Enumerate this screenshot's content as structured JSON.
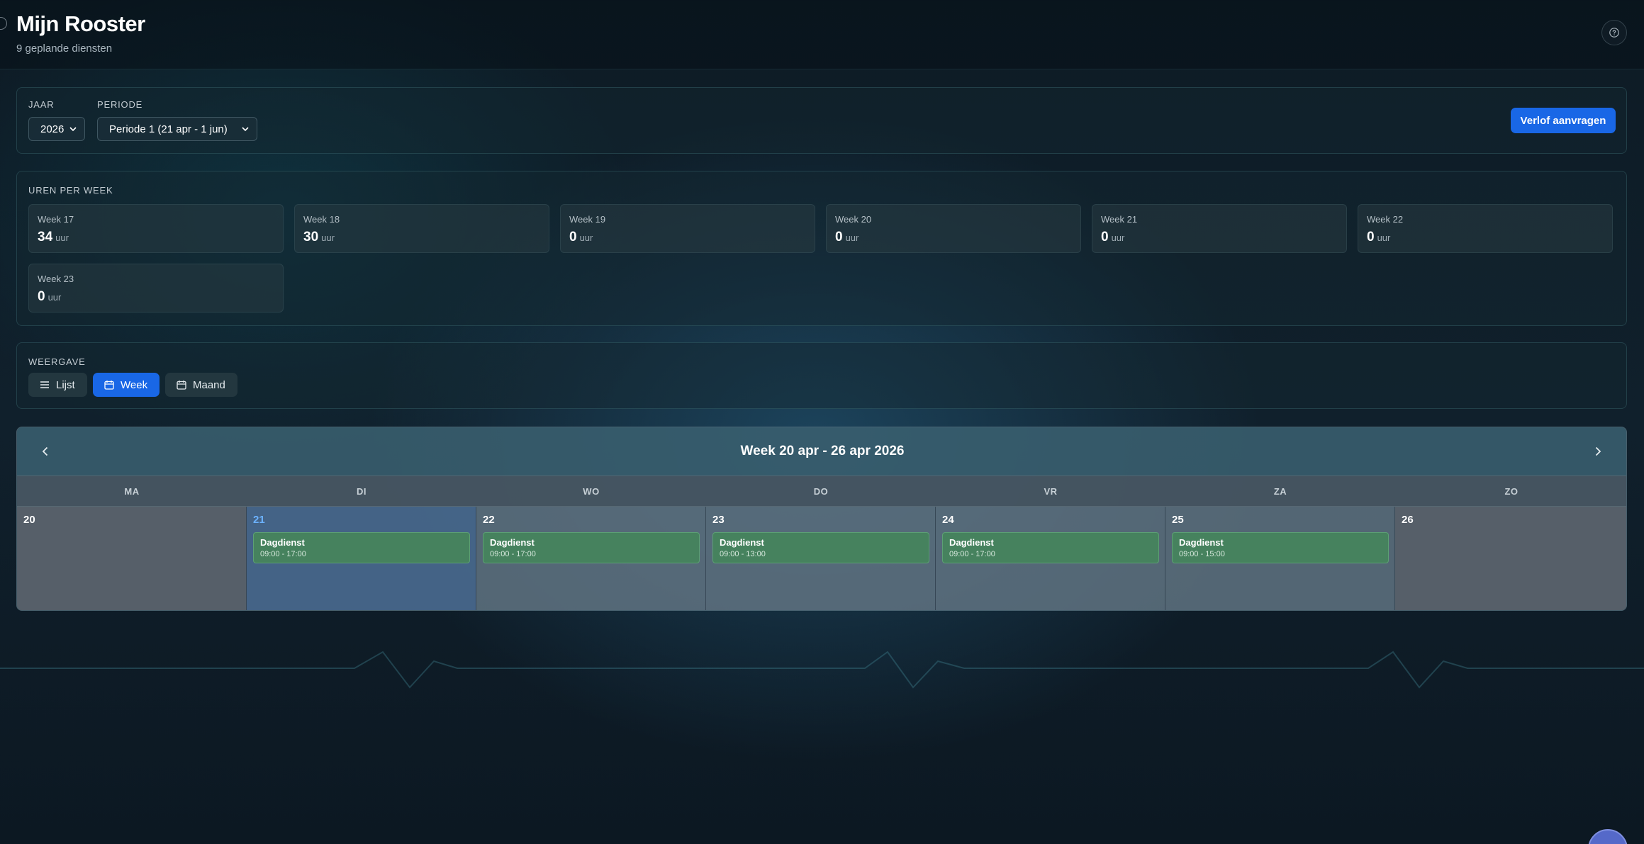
{
  "header": {
    "title": "Mijn Rooster",
    "subtitle": "9 geplande diensten",
    "help_icon": "help-circle-icon"
  },
  "filters": {
    "year_label": "JAAR",
    "year_value": "2026",
    "period_label": "PERIODE",
    "period_value": "Periode 1 (21 apr - 1 jun)",
    "leave_button": "Verlof aanvragen"
  },
  "hours": {
    "title": "UREN PER WEEK",
    "unit": "uur",
    "weeks": [
      {
        "label": "Week 17",
        "value": "34"
      },
      {
        "label": "Week 18",
        "value": "30"
      },
      {
        "label": "Week 19",
        "value": "0"
      },
      {
        "label": "Week 20",
        "value": "0"
      },
      {
        "label": "Week 21",
        "value": "0"
      },
      {
        "label": "Week 22",
        "value": "0"
      },
      {
        "label": "Week 23",
        "value": "0"
      }
    ]
  },
  "view": {
    "title": "WEERGAVE",
    "options": [
      {
        "label": "Lijst",
        "icon": "list-icon",
        "active": false
      },
      {
        "label": "Week",
        "icon": "calendar-icon",
        "active": true
      },
      {
        "label": "Maand",
        "icon": "calendar-icon",
        "active": false
      }
    ]
  },
  "calendar": {
    "title": "Week 20 apr - 26 apr 2026",
    "days": [
      {
        "dow": "MA",
        "date": "20",
        "state": "muted",
        "shift": null
      },
      {
        "dow": "DI",
        "date": "21",
        "state": "today",
        "shift": {
          "name": "Dagdienst",
          "time": "09:00 - 17:00"
        }
      },
      {
        "dow": "WO",
        "date": "22",
        "state": "normal",
        "shift": {
          "name": "Dagdienst",
          "time": "09:00 - 17:00"
        }
      },
      {
        "dow": "DO",
        "date": "23",
        "state": "normal",
        "shift": {
          "name": "Dagdienst",
          "time": "09:00 - 13:00"
        }
      },
      {
        "dow": "VR",
        "date": "24",
        "state": "normal",
        "shift": {
          "name": "Dagdienst",
          "time": "09:00 - 17:00"
        }
      },
      {
        "dow": "ZA",
        "date": "25",
        "state": "normal",
        "shift": {
          "name": "Dagdienst",
          "time": "09:00 - 15:00"
        }
      },
      {
        "dow": "ZO",
        "date": "26",
        "state": "muted",
        "shift": null
      }
    ]
  },
  "colors": {
    "accent": "#1967e6",
    "shift": "#46825e",
    "today_date": "#6cb2ff"
  }
}
